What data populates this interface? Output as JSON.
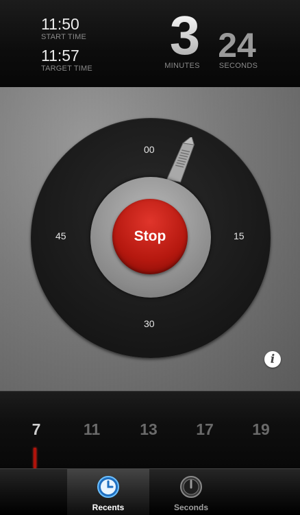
{
  "header": {
    "start_time": "11:50",
    "start_label": "START TIME",
    "target_time": "11:57",
    "target_label": "TARGET TIME",
    "minutes_value": "3",
    "minutes_label": "MINUTES",
    "seconds_value": "24",
    "seconds_label": "SECONDS"
  },
  "dial": {
    "mark_top": "00",
    "mark_right": "15",
    "mark_bottom": "30",
    "mark_left": "45",
    "stop_label": "Stop"
  },
  "info_label": "i",
  "recents": {
    "items": [
      "7",
      "11",
      "13",
      "17",
      "19"
    ],
    "selected_index": 0
  },
  "tabbar": {
    "tabs": [
      {
        "label": "Recents",
        "icon": "clock-icon",
        "active": true
      },
      {
        "label": "Seconds",
        "icon": "stopwatch-icon",
        "active": false
      }
    ]
  },
  "colors": {
    "accent": "#b5180f",
    "tab_active_icon": "#2f8fe0"
  }
}
